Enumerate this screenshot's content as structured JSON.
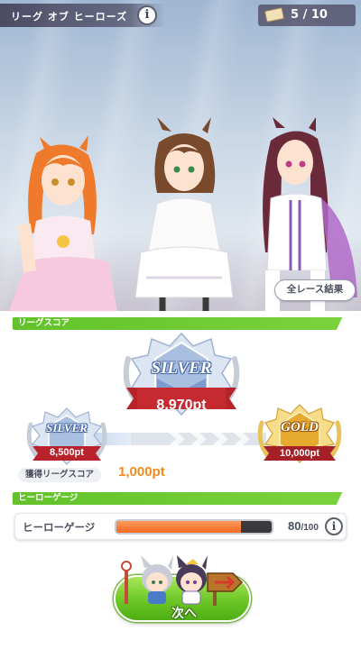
{
  "header": {
    "title": "リーグ オブ ヒーローズ",
    "ticket_count": "5 / 10"
  },
  "scene": {
    "all_results_label": "全レース結果"
  },
  "league_score": {
    "section_title": "リーグスコア",
    "current_rank": "SILVER",
    "current_score": "8,970pt",
    "current_progress_fraction": 0.25,
    "prev_rank": "SILVER",
    "prev_threshold": "8,500pt",
    "next_rank": "GOLD",
    "next_threshold": "10,000pt",
    "earned_label": "獲得リーグスコア",
    "earned_value": "1,000pt"
  },
  "hero_gauge": {
    "section_title": "ヒーローゲージ",
    "label": "ヒーローゲージ",
    "current": "80",
    "max": "/100",
    "fill_fraction": 0.8
  },
  "next_button": {
    "label": "次へ"
  },
  "colors": {
    "section_green": "#6cc627",
    "score_orange": "#f08a1c",
    "gauge_orange": "#f26a21",
    "silver_blue": "#7c97cc",
    "gold": "#e0a21f",
    "ribbon_red": "#b8232b"
  },
  "icons": {
    "info": "info-icon",
    "ticket": "ticket-icon",
    "next_arrow": "arrow-sign-icon"
  }
}
